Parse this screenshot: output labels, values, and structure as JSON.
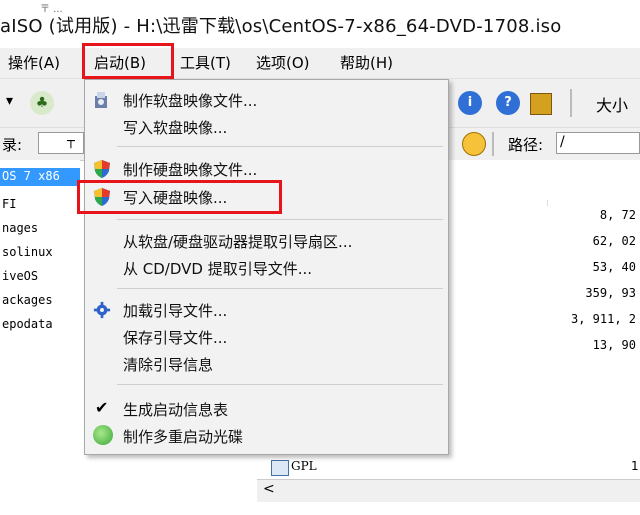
{
  "title_bar": {
    "title": "aISO (试用版) - H:\\迅雷下载\\os\\CentOS-7-x86_64-DVD-1708.iso",
    "stub": "〒 ..."
  },
  "menubar": {
    "items": [
      {
        "label": "操作(A)"
      },
      {
        "label": "启动(B)"
      },
      {
        "label": "工具(T)"
      },
      {
        "label": "选项(O)"
      },
      {
        "label": "帮助(H)"
      }
    ]
  },
  "toolbar": {
    "size_label": "大小"
  },
  "address_bar": {
    "left_label": "录:",
    "left_value": "┬",
    "path_label": "路径:",
    "path_value": "/"
  },
  "left_tree": {
    "selected": "OS 7 x86",
    "items": [
      "FI",
      "nages",
      "solinux",
      "iveOS",
      "ackages",
      "epodata"
    ]
  },
  "file_sizes": [
    "8, 72",
    "62, 02",
    "53, 40",
    "359, 93",
    "3, 911, 2",
    "13, 90"
  ],
  "dropdown": {
    "items": [
      {
        "label": "制作软盘映像文件...",
        "icon": "floppy-install-icon"
      },
      {
        "label": "写入软盘映像..."
      },
      {
        "label": "制作硬盘映像文件...",
        "icon": "shield-icon"
      },
      {
        "label": "写入硬盘映像...",
        "icon": "shield-icon",
        "highlighted": true
      },
      {
        "label": "从软盘/硬盘驱动器提取引导扇区..."
      },
      {
        "label": "从 CD/DVD 提取引导文件..."
      },
      {
        "label": "加载引导文件...",
        "icon": "gear-icon"
      },
      {
        "label": "保存引导文件..."
      },
      {
        "label": "清除引导信息"
      },
      {
        "label": "生成启动信息表",
        "checked": true
      },
      {
        "label": "制作多重启动光碟",
        "icon": "green-disc-icon"
      }
    ]
  },
  "bottom": {
    "file_name": "GPL",
    "file_size": "1",
    "scroll_left": "<"
  },
  "colors": {
    "highlight_box": "#e8141b",
    "menu_bg": "#f2f2f2",
    "selection": "#3399ff"
  }
}
